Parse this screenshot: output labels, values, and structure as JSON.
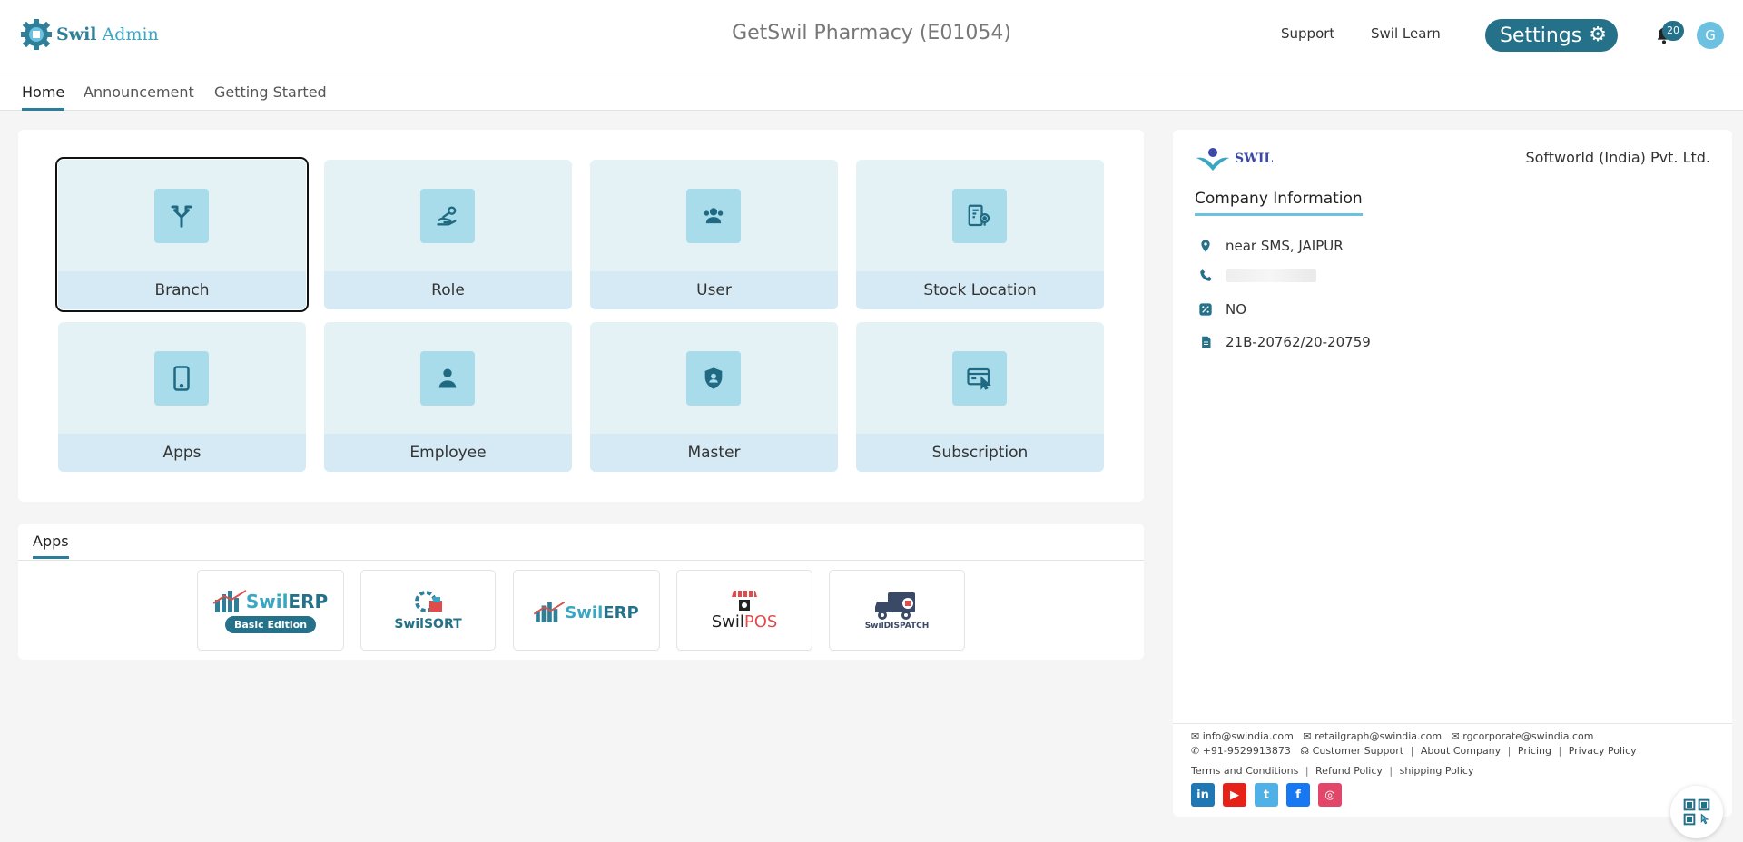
{
  "header": {
    "brand_primary": "Swil",
    "brand_secondary": "Admin",
    "title": "GetSwil Pharmacy (E01054)",
    "support_label": "Support",
    "learn_label": "Swil Learn",
    "settings_label": "Settings",
    "notification_count": "20",
    "avatar_initial": "G"
  },
  "tabs": [
    {
      "label": "Home",
      "active": true
    },
    {
      "label": "Announcement",
      "active": false
    },
    {
      "label": "Getting Started",
      "active": false
    }
  ],
  "modules": [
    {
      "label": "Branch",
      "icon": "branch-icon",
      "selected": true
    },
    {
      "label": "Role",
      "icon": "role-key-icon"
    },
    {
      "label": "User",
      "icon": "users-icon"
    },
    {
      "label": "Stock Location",
      "icon": "stock-location-icon"
    },
    {
      "label": "Apps",
      "icon": "mobile-icon"
    },
    {
      "label": "Employee",
      "icon": "employee-icon"
    },
    {
      "label": "Master",
      "icon": "shield-user-icon"
    },
    {
      "label": "Subscription",
      "icon": "subscription-icon"
    }
  ],
  "apps": {
    "tab_label": "Apps",
    "items": [
      {
        "name_a": "Swil",
        "name_b": "ERP",
        "badge": "Basic Edition"
      },
      {
        "name_a": "Swil",
        "name_b": "SORT"
      },
      {
        "name_a": "Swil",
        "name_b": "ERP"
      },
      {
        "name_a": "Swil",
        "name_b": "POS"
      },
      {
        "name_a": "Swil",
        "name_b": "DISPATCH"
      }
    ]
  },
  "company": {
    "logo_text": "SWIL",
    "name": "Softworld (India) Pvt. Ltd.",
    "section_title": "Company Information",
    "address": "near SMS, JAIPUR",
    "gst_flag": "NO",
    "license_no": "21B-20762/20-20759"
  },
  "footer": {
    "email_info": "info@swindia.com",
    "email_retail": "retailgraph@swindia.com",
    "email_corporate": "rgcorporate@swindia.com",
    "phone": "+91-9529913873",
    "customer_support": "Customer Support",
    "about_company": "About Company",
    "pricing": "Pricing",
    "privacy_policy": "Privacy Policy",
    "terms": "Terms and Conditions",
    "refund": "Refund Policy",
    "shipping": "shipping Policy"
  },
  "colors": {
    "primary": "#25718a",
    "tile_bg": "#e4f2f6",
    "tile_label_bg": "#d5eaf4",
    "icon_box": "#a9dcea"
  }
}
